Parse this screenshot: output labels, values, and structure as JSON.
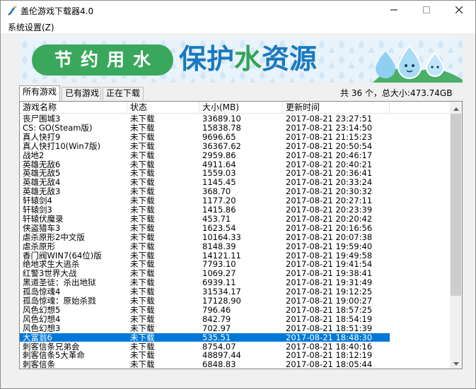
{
  "window": {
    "title": "盖伦游戏下载器4.0"
  },
  "menu": {
    "settings_label": "系统设置(Z)"
  },
  "banner": {
    "slogan": "节约用水",
    "headline_part1": "保护",
    "headline_part2": "水",
    "headline_part3": "资源",
    "colors": {
      "green": "#3aa85c",
      "blue": "#1979bf"
    }
  },
  "tabs": [
    {
      "label": "所有游戏",
      "active": true
    },
    {
      "label": "已有游戏",
      "active": false
    },
    {
      "label": "正在下载",
      "active": false
    }
  ],
  "summary": "共 36 个，总大小:473.74GB",
  "table": {
    "columns": [
      "游戏名称",
      "状态",
      "大小(MB)",
      "更新时间"
    ],
    "selected_index": 24,
    "rows": [
      [
        "丧尸围城3",
        "未下载",
        "33689.10",
        "2017-08-21 23:27:51"
      ],
      [
        "CS: GO(Steam版)",
        "未下载",
        "15838.78",
        "2017-08-21 23:14:50"
      ],
      [
        "真人快打9",
        "未下载",
        "9696.65",
        "2017-08-21 21:15:23"
      ],
      [
        "真人快打10(Win7版)",
        "未下载",
        "36367.62",
        "2017-08-21 20:50:54"
      ],
      [
        "战地2",
        "未下载",
        "2959.86",
        "2017-08-21 20:46:17"
      ],
      [
        "英雄无敌6",
        "未下载",
        "4911.64",
        "2017-08-21 20:40:21"
      ],
      [
        "英雄无敌5",
        "未下载",
        "1559.03",
        "2017-08-21 20:36:41"
      ],
      [
        "英雄无敌4",
        "未下载",
        "1145.45",
        "2017-08-21 20:33:24"
      ],
      [
        "英雄无敌3",
        "未下载",
        "368.70",
        "2017-08-21 20:30:32"
      ],
      [
        "轩辕剑4",
        "未下载",
        "1177.20",
        "2017-08-21 20:27:11"
      ],
      [
        "轩辕剑3",
        "未下载",
        "1415.86",
        "2017-08-21 20:23:39"
      ],
      [
        "轩辕伏魔录",
        "未下载",
        "453.71",
        "2017-08-21 20:20:42"
      ],
      [
        "侠盗猎车3",
        "未下载",
        "1623.54",
        "2017-08-21 20:16:56"
      ],
      [
        "虐杀原形2中文版",
        "未下载",
        "10164.33",
        "2017-08-21 20:07:38"
      ],
      [
        "虐杀原形",
        "未下载",
        "8148.39",
        "2017-08-21 19:59:40"
      ],
      [
        "香门阀WIN7(64位)版",
        "未下载",
        "14121.11",
        "2017-08-21 19:49:58"
      ],
      [
        "绝地求生大逃杀",
        "未下载",
        "7793.10",
        "2017-08-21 19:41:54"
      ],
      [
        "红警3世界大战",
        "未下载",
        "1069.27",
        "2017-08-21 19:38:41"
      ],
      [
        "黑道圣徒：杀出地狱",
        "未下载",
        "6939.11",
        "2017-08-21 19:31:49"
      ],
      [
        "孤岛惊魂4",
        "未下载",
        "31534.17",
        "2017-08-21 19:12:25"
      ],
      [
        "孤岛惊魂：原始杀戮",
        "未下载",
        "17128.90",
        "2017-08-21 19:00:27"
      ],
      [
        "风色幻想5",
        "未下载",
        "796.46",
        "2017-08-21 18:57:25"
      ],
      [
        "风色幻想4",
        "未下载",
        "842.79",
        "2017-08-21 18:54:19"
      ],
      [
        "风色幻想3",
        "未下载",
        "702.97",
        "2017-08-21 18:51:39"
      ],
      [
        "大富翁6",
        "未下载",
        "535.51",
        "2017-08-21 18:48:30"
      ],
      [
        "刺客信条兄弟会",
        "未下载",
        "8754.07",
        "2017-08-21 18:40:16"
      ],
      [
        "刺客信条5大革命",
        "未下载",
        "48897.44",
        "2017-08-21 18:12:19"
      ],
      [
        "刺客信条",
        "未下载",
        "6848.83",
        "2017-08-21 18:05:44"
      ]
    ]
  }
}
